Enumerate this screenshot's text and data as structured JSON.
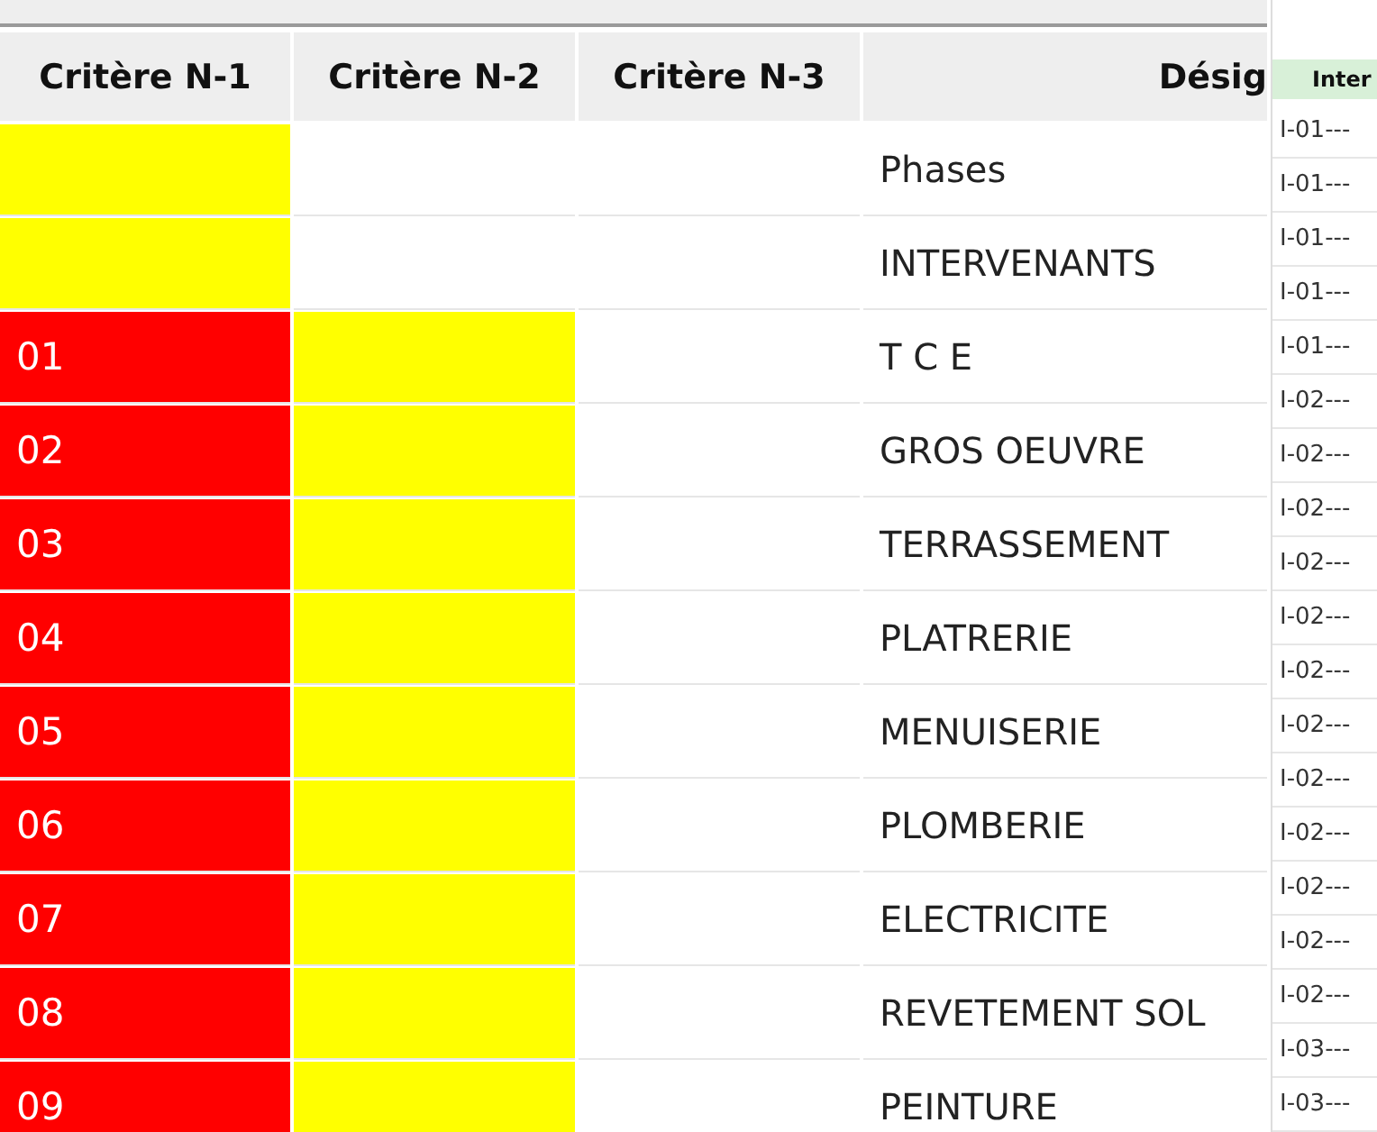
{
  "criteria_table": {
    "columns": [
      "Critère N-1",
      "Critère N-2",
      "Critère N-3",
      "Désig"
    ],
    "rows": [
      {
        "criterion_1": {
          "color": "#ffff00"
        },
        "designation": "Phases"
      },
      {
        "criterion_1": {
          "color": "#ffff00"
        },
        "designation": "INTERVENANTS"
      },
      {
        "criterion_1": {
          "text": "01",
          "color": "#ff0000"
        },
        "criterion_2": {
          "color": "#ffff00"
        },
        "designation": "T C E"
      },
      {
        "criterion_1": {
          "text": "02",
          "color": "#ff0000"
        },
        "criterion_2": {
          "color": "#ffff00"
        },
        "designation": "GROS OEUVRE"
      },
      {
        "criterion_1": {
          "text": "03",
          "color": "#ff0000"
        },
        "criterion_2": {
          "color": "#ffff00"
        },
        "designation": "TERRASSEMENT"
      },
      {
        "criterion_1": {
          "text": "04",
          "color": "#ff0000"
        },
        "criterion_2": {
          "color": "#ffff00"
        },
        "designation": "PLATRERIE"
      },
      {
        "criterion_1": {
          "text": "05",
          "color": "#ff0000"
        },
        "criterion_2": {
          "color": "#ffff00"
        },
        "designation": "MENUISERIE"
      },
      {
        "criterion_1": {
          "text": "06",
          "color": "#ff0000"
        },
        "criterion_2": {
          "color": "#ffff00"
        },
        "designation": "PLOMBERIE"
      },
      {
        "criterion_1": {
          "text": "07",
          "color": "#ff0000"
        },
        "criterion_2": {
          "color": "#ffff00"
        },
        "designation": "ELECTRICITE"
      },
      {
        "criterion_1": {
          "text": "08",
          "color": "#ff0000"
        },
        "criterion_2": {
          "color": "#ffff00"
        },
        "designation": "REVETEMENT SOL"
      },
      {
        "criterion_1": {
          "text": "09",
          "color": "#ff0000"
        },
        "criterion_2": {
          "color": "#ffff00"
        },
        "designation": "PEINTURE"
      }
    ]
  },
  "side_table": {
    "column": "Inter",
    "rows": [
      "I-01---",
      "I-01---",
      "I-01---",
      "I-01---",
      "I-01---",
      "I-02---",
      "I-02---",
      "I-02---",
      "I-02---",
      "I-02---",
      "I-02---",
      "I-02---",
      "I-02---",
      "I-02---",
      "I-02---",
      "I-02---",
      "I-02---",
      "I-03---",
      "I-03---"
    ]
  }
}
